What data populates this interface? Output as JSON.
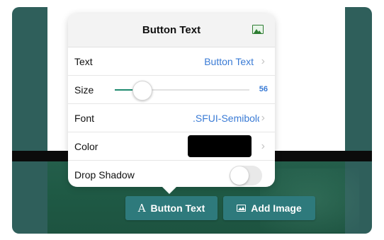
{
  "popover": {
    "title": "Button Text",
    "header_icon": "image-icon",
    "rows": {
      "text": {
        "label": "Text",
        "value": "Button Text"
      },
      "size": {
        "label": "Size",
        "value": "56",
        "slider_fraction": 0.2
      },
      "font": {
        "label": "Font",
        "value": ".SFUI-Semibold"
      },
      "color": {
        "label": "Color",
        "swatch": "#000000"
      },
      "drop_shadow": {
        "label": "Drop Shadow",
        "enabled": false
      }
    }
  },
  "toolbar": {
    "button_text_glyph": "A",
    "button_text_label": "Button Text",
    "add_image_label": "Add Image"
  },
  "colors": {
    "accent": "#3a7bd5",
    "slider": "#1f8a6f",
    "button": "#2e7a7c",
    "background": "#2f5f5b"
  }
}
